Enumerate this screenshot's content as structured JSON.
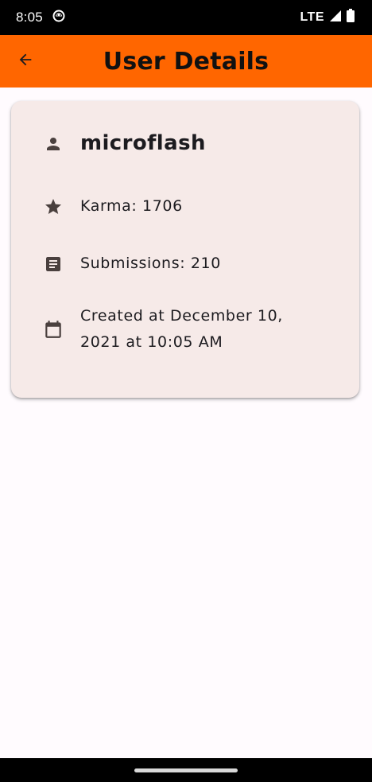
{
  "status_bar": {
    "time": "8:05",
    "network": "LTE",
    "icons": [
      "android-notification-icon",
      "signal-icon",
      "battery-icon"
    ]
  },
  "app_bar": {
    "title": "User Details",
    "back_icon": "arrow-back-icon",
    "color": "#ff6600"
  },
  "user": {
    "username": "microflash",
    "karma_text": "Karma: 1706",
    "submissions_text": "Submissions: 210",
    "created_text": "Created at December 10, 2021 at 10:05 AM",
    "icons": {
      "username": "person-icon",
      "karma": "star-icon",
      "submissions": "article-icon",
      "created": "calendar-icon"
    }
  },
  "colors": {
    "card_bg": "#f6eae8",
    "icon": "#4a403e",
    "page_bg": "#fffbfe"
  }
}
